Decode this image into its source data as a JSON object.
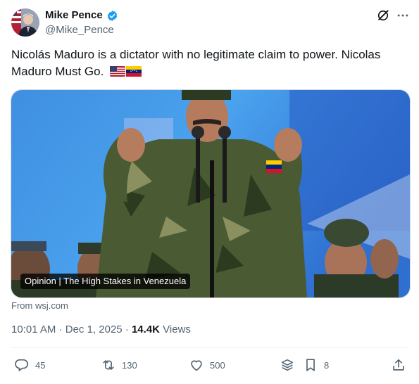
{
  "author": {
    "name": "Mike Pence",
    "handle": "@Mike_Pence"
  },
  "tweet": {
    "text": "Nicolás Maduro is a dictator with no legitimate claim to power. Nicolas Maduro Must Go.",
    "emojis": [
      "us-flag-emoji",
      "venezuela-flag-emoji"
    ]
  },
  "card": {
    "caption": "Opinion | The High Stakes in Venezuela",
    "source": "From wsj.com"
  },
  "meta": {
    "time": "10:01 AM",
    "separator1": " · ",
    "date": "Dec 1, 2025",
    "separator2": " · ",
    "views_count": "14.4K",
    "views_label": " Views"
  },
  "actions": {
    "replies": "45",
    "reposts": "130",
    "likes": "500",
    "bookmarks": "8"
  },
  "colors": {
    "accent": "#1d9bf0",
    "text": "#0f1419",
    "muted": "#536471"
  }
}
